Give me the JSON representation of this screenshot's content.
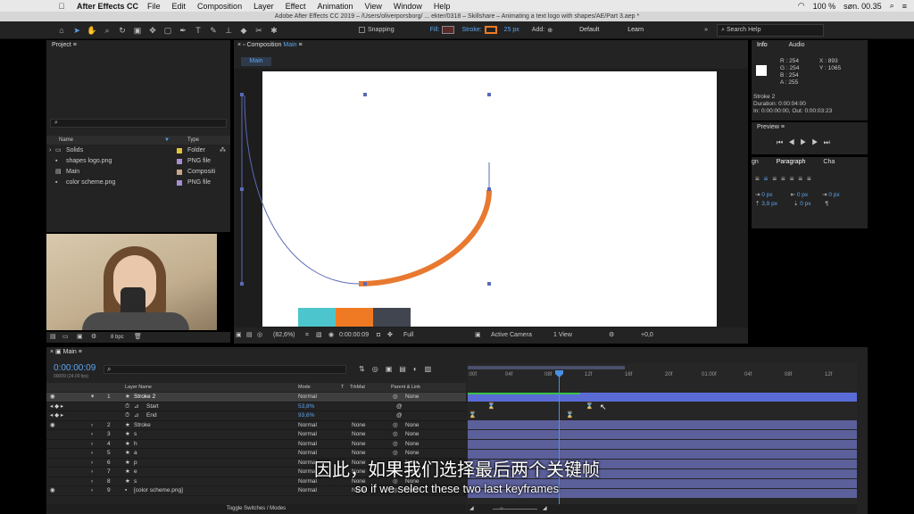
{
  "menubar": {
    "app": "After Effects CC",
    "items": [
      "File",
      "Edit",
      "Composition",
      "Layer",
      "Effect",
      "Animation",
      "View",
      "Window",
      "Help"
    ],
    "battery": "100 %",
    "clock": "søn. 00.35"
  },
  "title": "Adobe After Effects CC 2019 – /Users/oliverporsborg/ ... ekter/0318 – Skillshare – Animating a text logo with shapes/AE/Part 3.aep *",
  "toolbar": {
    "snapping": "Snapping",
    "fill": "Fill:",
    "stroke": "Stroke:",
    "stroke_px": "25 px",
    "add": "Add:",
    "workspace_default": "Default",
    "workspace_learn": "Learn",
    "search_help": "Search Help"
  },
  "project": {
    "title": "Project",
    "col_name": "Name",
    "col_type": "Type",
    "items": [
      {
        "name": "Solids",
        "type": "Folder",
        "color": "#e0c43a"
      },
      {
        "name": "shapes logo.png",
        "type": "PNG file",
        "color": "#a58fd1"
      },
      {
        "name": "Main",
        "type": "Compositi",
        "color": "#c9a68a"
      },
      {
        "name": "color scheme.png",
        "type": "PNG file",
        "color": "#a58fd1"
      }
    ],
    "bpc": "8 bpc"
  },
  "comp": {
    "panel_title": "Composition",
    "panel_name": "Main",
    "tab": "Main",
    "zoom": "(82,6%)",
    "time": "0:00:00:09",
    "quality": "Full",
    "camera": "Active Camera",
    "views": "1 View",
    "exposure": "+0,0"
  },
  "colors": {
    "teal": "#4cc6cc",
    "orange": "#f07a23",
    "dark": "#414550",
    "stroke": "#e87930"
  },
  "info": {
    "tab_info": "Info",
    "tab_audio": "Audio",
    "r": "R : 254",
    "g": "G : 254",
    "b": "B : 254",
    "a": "A : 255",
    "x": "X : 893",
    "y": "Y : 1065",
    "layer": "Stroke 2",
    "duration": "Duration: 0:00:04:00",
    "inout": "In: 0:00:00:00, Out: 0:00:03:23"
  },
  "preview": {
    "title": "Preview"
  },
  "paragraph": {
    "tab_left": "gn",
    "tab": "Paragraph",
    "tab_right": "Cha",
    "v1": "0 px",
    "v2": "0 px",
    "v3": "0 px",
    "v4": "3,9 px",
    "v5": "0 px",
    "v6": "0 px"
  },
  "timeline": {
    "tab": "Main",
    "timecode": "0:00:00:09",
    "fps": "00009 (24.00 fps)",
    "col_layer": "Layer Name",
    "col_mode": "Mode",
    "col_t": "T",
    "col_trkmat": "TrkMat",
    "col_parent": "Parent & Link",
    "ruler": [
      ":00f",
      "04f",
      "08f",
      "12f",
      "16f",
      "20f",
      "01:00f",
      "04f",
      "08f",
      "12f"
    ],
    "toggle": "Toggle Switches / Modes",
    "layers": [
      {
        "num": "1",
        "name": "Stroke 2",
        "mode": "Normal",
        "trk": "",
        "parent": "None",
        "sel": true
      },
      {
        "num": "",
        "name": "Start",
        "mode": "53,8%",
        "trk": "",
        "parent": "",
        "sub": true
      },
      {
        "num": "",
        "name": "End",
        "mode": "93,6%",
        "trk": "",
        "parent": "",
        "sub": true
      },
      {
        "num": "2",
        "name": "Stroke",
        "mode": "Normal",
        "trk": "None",
        "parent": "None"
      },
      {
        "num": "3",
        "name": "s",
        "mode": "Normal",
        "trk": "None",
        "parent": "None"
      },
      {
        "num": "4",
        "name": "h",
        "mode": "Normal",
        "trk": "None",
        "parent": "None"
      },
      {
        "num": "5",
        "name": "a",
        "mode": "Normal",
        "trk": "None",
        "parent": "None"
      },
      {
        "num": "6",
        "name": "p",
        "mode": "Normal",
        "trk": "None",
        "parent": "None"
      },
      {
        "num": "7",
        "name": "e",
        "mode": "Normal",
        "trk": "None",
        "parent": "None"
      },
      {
        "num": "8",
        "name": "s",
        "mode": "Normal",
        "trk": "None",
        "parent": "None"
      },
      {
        "num": "9",
        "name": "[color scheme.png]",
        "mode": "Normal",
        "trk": "None",
        "parent": "None"
      }
    ]
  },
  "subtitles": {
    "zh": "因此，如果我们选择最后两个关键帧",
    "en": "so if we select these two last keyframes"
  }
}
